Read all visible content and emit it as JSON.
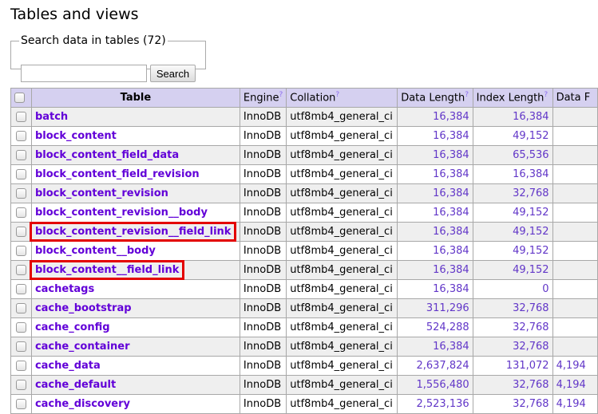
{
  "page": {
    "title": "Tables and views"
  },
  "search": {
    "legend": "Search data in tables (72)",
    "input_value": "",
    "input_placeholder": "",
    "button_label": "Search"
  },
  "table": {
    "columns": [
      {
        "label": "",
        "help": ""
      },
      {
        "label": "Table",
        "help": ""
      },
      {
        "label": "Engine",
        "help": "?"
      },
      {
        "label": "Collation",
        "help": "?"
      },
      {
        "label": "Data Length",
        "help": "?"
      },
      {
        "label": "Index Length",
        "help": "?"
      },
      {
        "label": "Data F",
        "help": ""
      }
    ],
    "rows": [
      {
        "name": "batch",
        "engine": "InnoDB",
        "collation": "utf8mb4_general_ci",
        "data_length": "16,384",
        "index_length": "16,384",
        "data_free": "",
        "highlighted": false
      },
      {
        "name": "block_content",
        "engine": "InnoDB",
        "collation": "utf8mb4_general_ci",
        "data_length": "16,384",
        "index_length": "49,152",
        "data_free": "",
        "highlighted": false
      },
      {
        "name": "block_content_field_data",
        "engine": "InnoDB",
        "collation": "utf8mb4_general_ci",
        "data_length": "16,384",
        "index_length": "65,536",
        "data_free": "",
        "highlighted": false
      },
      {
        "name": "block_content_field_revision",
        "engine": "InnoDB",
        "collation": "utf8mb4_general_ci",
        "data_length": "16,384",
        "index_length": "16,384",
        "data_free": "",
        "highlighted": false
      },
      {
        "name": "block_content_revision",
        "engine": "InnoDB",
        "collation": "utf8mb4_general_ci",
        "data_length": "16,384",
        "index_length": "32,768",
        "data_free": "",
        "highlighted": false
      },
      {
        "name": "block_content_revision__body",
        "engine": "InnoDB",
        "collation": "utf8mb4_general_ci",
        "data_length": "16,384",
        "index_length": "49,152",
        "data_free": "",
        "highlighted": false
      },
      {
        "name": "block_content_revision__field_link",
        "engine": "InnoDB",
        "collation": "utf8mb4_general_ci",
        "data_length": "16,384",
        "index_length": "49,152",
        "data_free": "",
        "highlighted": true
      },
      {
        "name": "block_content__body",
        "engine": "InnoDB",
        "collation": "utf8mb4_general_ci",
        "data_length": "16,384",
        "index_length": "49,152",
        "data_free": "",
        "highlighted": false
      },
      {
        "name": "block_content__field_link",
        "engine": "InnoDB",
        "collation": "utf8mb4_general_ci",
        "data_length": "16,384",
        "index_length": "49,152",
        "data_free": "",
        "highlighted": true
      },
      {
        "name": "cachetags",
        "engine": "InnoDB",
        "collation": "utf8mb4_general_ci",
        "data_length": "16,384",
        "index_length": "0",
        "data_free": "",
        "highlighted": false
      },
      {
        "name": "cache_bootstrap",
        "engine": "InnoDB",
        "collation": "utf8mb4_general_ci",
        "data_length": "311,296",
        "index_length": "32,768",
        "data_free": "",
        "highlighted": false
      },
      {
        "name": "cache_config",
        "engine": "InnoDB",
        "collation": "utf8mb4_general_ci",
        "data_length": "524,288",
        "index_length": "32,768",
        "data_free": "",
        "highlighted": false
      },
      {
        "name": "cache_container",
        "engine": "InnoDB",
        "collation": "utf8mb4_general_ci",
        "data_length": "16,384",
        "index_length": "32,768",
        "data_free": "",
        "highlighted": false
      },
      {
        "name": "cache_data",
        "engine": "InnoDB",
        "collation": "utf8mb4_general_ci",
        "data_length": "2,637,824",
        "index_length": "131,072",
        "data_free": "4,194",
        "highlighted": false
      },
      {
        "name": "cache_default",
        "engine": "InnoDB",
        "collation": "utf8mb4_general_ci",
        "data_length": "1,556,480",
        "index_length": "32,768",
        "data_free": "4,194",
        "highlighted": false
      },
      {
        "name": "cache_discovery",
        "engine": "InnoDB",
        "collation": "utf8mb4_general_ci",
        "data_length": "2,523,136",
        "index_length": "32,768",
        "data_free": "4,194",
        "highlighted": false
      }
    ]
  },
  "colors": {
    "link": "#6200d8",
    "number": "#6237c8",
    "header_bg": "#d5d0f0",
    "highlight_box": "#e30000"
  }
}
